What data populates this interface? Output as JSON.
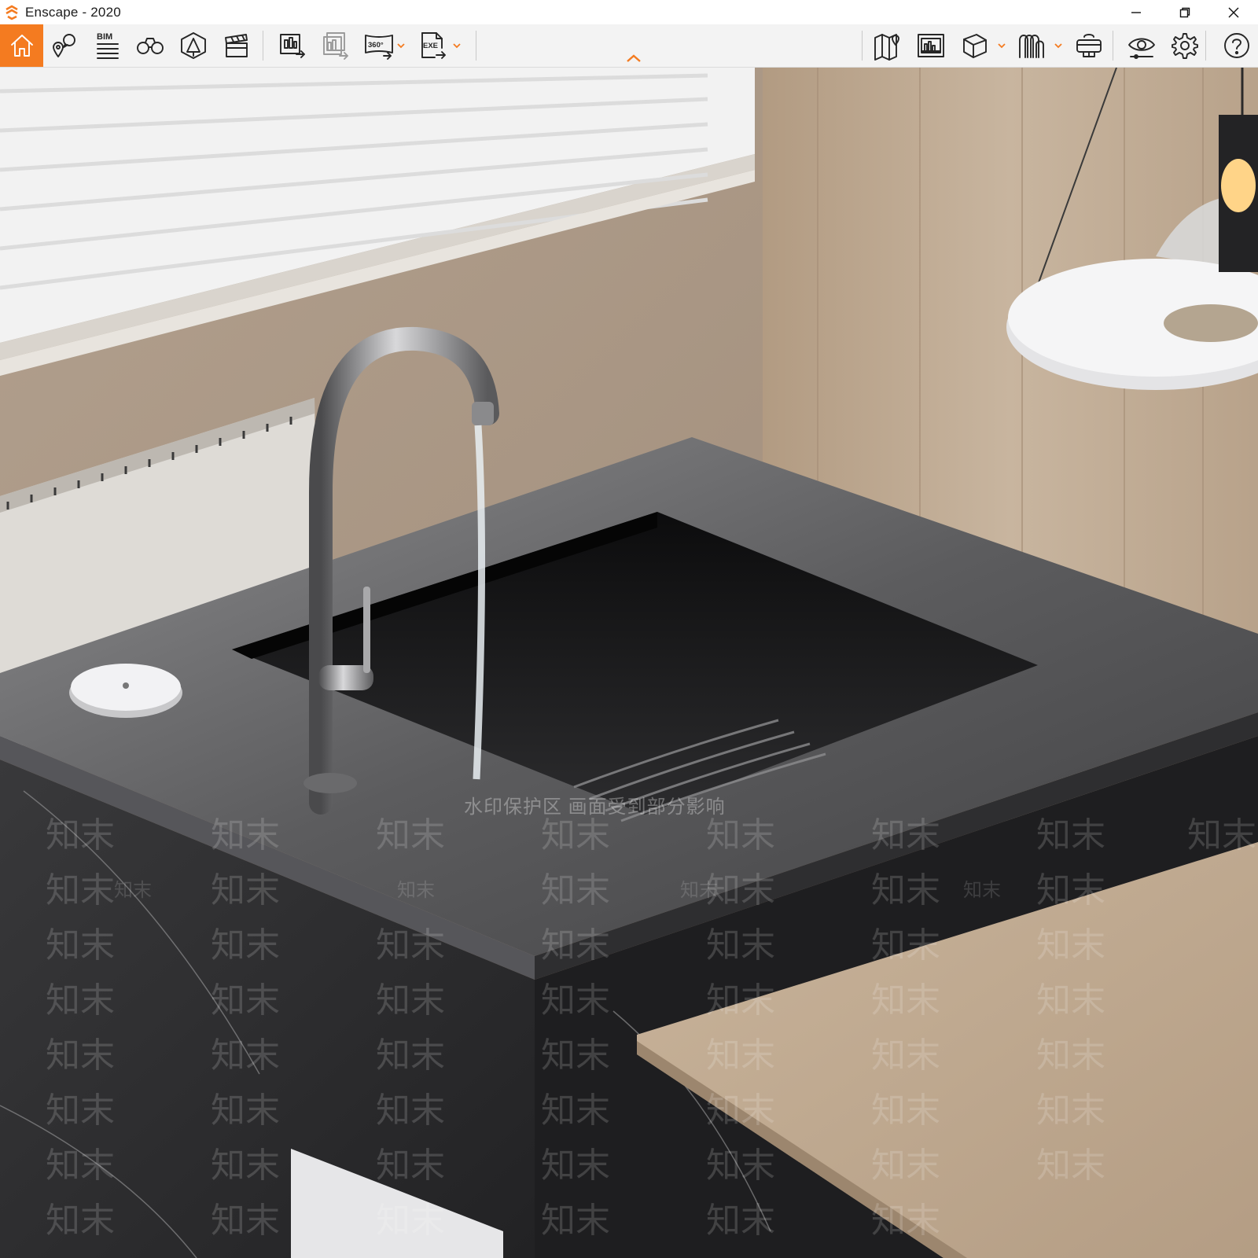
{
  "window": {
    "app_name": "Enscape",
    "title": "Enscape - 2020",
    "brand_color": "#f47b20",
    "controls": {
      "minimize": "minimize-icon",
      "restore": "restore-icon",
      "close": "close-icon"
    }
  },
  "toolbar": {
    "left_items": [
      {
        "id": "home",
        "icon": "home-icon",
        "active": true
      },
      {
        "id": "views",
        "icon": "location-bubble-icon"
      },
      {
        "id": "bim",
        "icon": "bim-list-icon",
        "label": "BIM"
      },
      {
        "id": "binoculars",
        "icon": "binoculars-icon"
      },
      {
        "id": "atmosphere",
        "icon": "atmosphere-icon"
      },
      {
        "id": "video",
        "icon": "clapperboard-icon"
      },
      {
        "id": "screenshot",
        "icon": "render-export-icon"
      },
      {
        "id": "batch",
        "icon": "batch-render-icon",
        "disabled": true
      },
      {
        "id": "panorama",
        "icon": "panorama-icon",
        "badge": "360°",
        "has_dropdown": true
      },
      {
        "id": "export",
        "icon": "export-file-icon",
        "badge": "EXE",
        "has_dropdown": true
      }
    ],
    "right_items": [
      {
        "id": "map",
        "icon": "map-pin-icon"
      },
      {
        "id": "render-view",
        "icon": "image-preview-icon"
      },
      {
        "id": "asset",
        "icon": "cube-icon",
        "has_dropdown": true
      },
      {
        "id": "materials",
        "icon": "material-icon",
        "has_dropdown": true
      },
      {
        "id": "vr",
        "icon": "vr-headset-icon"
      },
      {
        "id": "visual-settings",
        "icon": "eye-settings-icon"
      },
      {
        "id": "settings",
        "icon": "gear-icon"
      },
      {
        "id": "help",
        "icon": "help-icon"
      }
    ],
    "collapse_icon": "chevron-up-icon"
  },
  "viewport": {
    "watermark_notice": "水印保护区 画面受到部分影响",
    "watermark_text": "知末"
  }
}
